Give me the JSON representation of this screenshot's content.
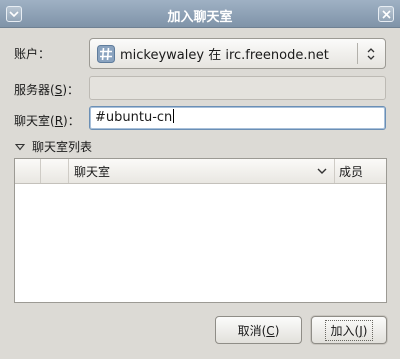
{
  "window": {
    "title": "加入聊天室"
  },
  "form": {
    "account_label": "账户：",
    "account_value": "mickeywaley 在 irc.freenode.net",
    "server_label_prefix": "服务器(",
    "server_label_mnemonic": "S",
    "server_label_suffix": ")：",
    "server_value": "",
    "room_label_prefix": "聊天室(",
    "room_label_mnemonic": "R",
    "room_label_suffix": ")：",
    "room_value": "#ubuntu-cn"
  },
  "room_list": {
    "expander_label": "聊天室列表",
    "columns": [
      "",
      "",
      "聊天室",
      "成员"
    ],
    "rows": []
  },
  "buttons": {
    "cancel_prefix": "取消(",
    "cancel_mnemonic": "C",
    "cancel_suffix": ")",
    "join_prefix": "加入(",
    "join_mnemonic": "J",
    "join_suffix": ")"
  },
  "colors": {
    "accent": "#6b8fb5",
    "titlebar": "#8fa2b6",
    "dialog_bg": "#dcdad5"
  },
  "icons": {
    "account": "irc-hash-icon",
    "combo_arrow": "up-down-arrows-icon",
    "expander": "triangle-down-icon",
    "sort": "chevron-down-icon",
    "window_menu": "window-menu-icon",
    "close": "close-icon"
  }
}
